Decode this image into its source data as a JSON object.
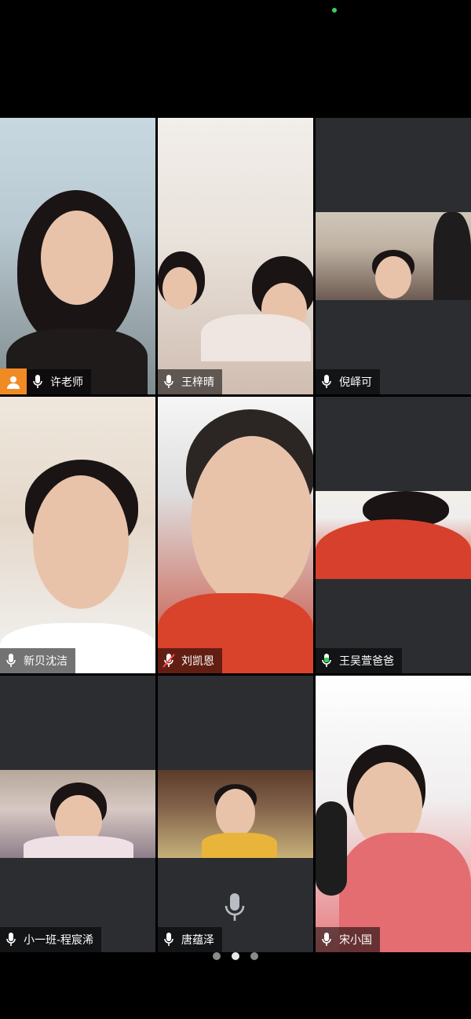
{
  "participants": [
    {
      "name": "许老师",
      "mic": "on",
      "badge": "host-avatar",
      "active": true
    },
    {
      "name": "王梓晴",
      "mic": "on"
    },
    {
      "name": "倪峄可",
      "mic": "on"
    },
    {
      "name": "新贝沈洁",
      "mic": "on"
    },
    {
      "name": "刘凯恩",
      "mic": "muted"
    },
    {
      "name": "王吴萱爸爸",
      "mic": "speaking"
    },
    {
      "name": "小一班-程宸浠",
      "mic": "on"
    },
    {
      "name": "唐蕴泽",
      "mic": "on"
    },
    {
      "name": "宋小国",
      "mic": "on"
    }
  ],
  "pagination": {
    "pages": 3,
    "current": 2
  },
  "colors": {
    "active_border": "#35d05a",
    "speaking_mic": "#35d05a",
    "muted_mic": "#ff4a4a",
    "host_badge": "#f08a25",
    "tile_bg": "#2b2d31"
  }
}
